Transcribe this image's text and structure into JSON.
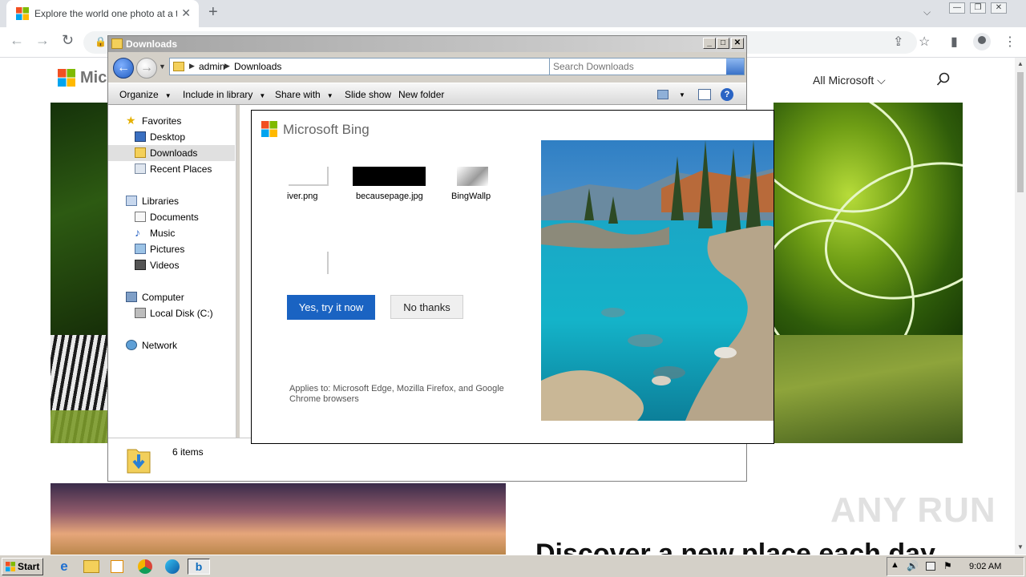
{
  "browser": {
    "tab_title": "Explore the world one photo at a time",
    "tab_close": "✕",
    "new_tab": "+",
    "window_controls": {
      "minimize": "—",
      "maximize": "❐",
      "close": "✕"
    }
  },
  "webpage": {
    "logo_text": "Mic",
    "nav_all_microsoft": "All Microsoft ⌵",
    "heading": "Discover a new place each day"
  },
  "explorer": {
    "title": "Downloads",
    "address": {
      "crumbs": [
        "admin",
        "Downloads"
      ]
    },
    "search_placeholder": "Search Downloads",
    "commands": {
      "organize": "Organize",
      "include_in_library": "Include in library",
      "share_with": "Share with",
      "slide_show": "Slide show",
      "new_folder": "New folder"
    },
    "nav": {
      "favorites": "Favorites",
      "desktop": "Desktop",
      "downloads": "Downloads",
      "recent_places": "Recent Places",
      "libraries": "Libraries",
      "documents": "Documents",
      "music": "Music",
      "pictures": "Pictures",
      "videos": "Videos",
      "computer": "Computer",
      "local_disk": "Local Disk (C:)",
      "network": "Network"
    },
    "status": "6 items"
  },
  "bing_dialog": {
    "title": "Microsoft Bing",
    "files": [
      "iver.png",
      "becausepage.jpg",
      "BingWallp"
    ],
    "yes_button": "Yes, try it now",
    "no_button": "No thanks",
    "applies_to": "Applies to: Microsoft Edge, Mozilla Firefox, and Google Chrome browsers"
  },
  "watermark": "ANY RUN",
  "taskbar": {
    "start": "Start",
    "clock": "9:02 AM"
  },
  "colors": {
    "bing_button": "#1a63c2",
    "ms_red": "#f25022",
    "ms_green": "#7fba00",
    "ms_blue": "#00a4ef",
    "ms_yellow": "#ffb900"
  }
}
